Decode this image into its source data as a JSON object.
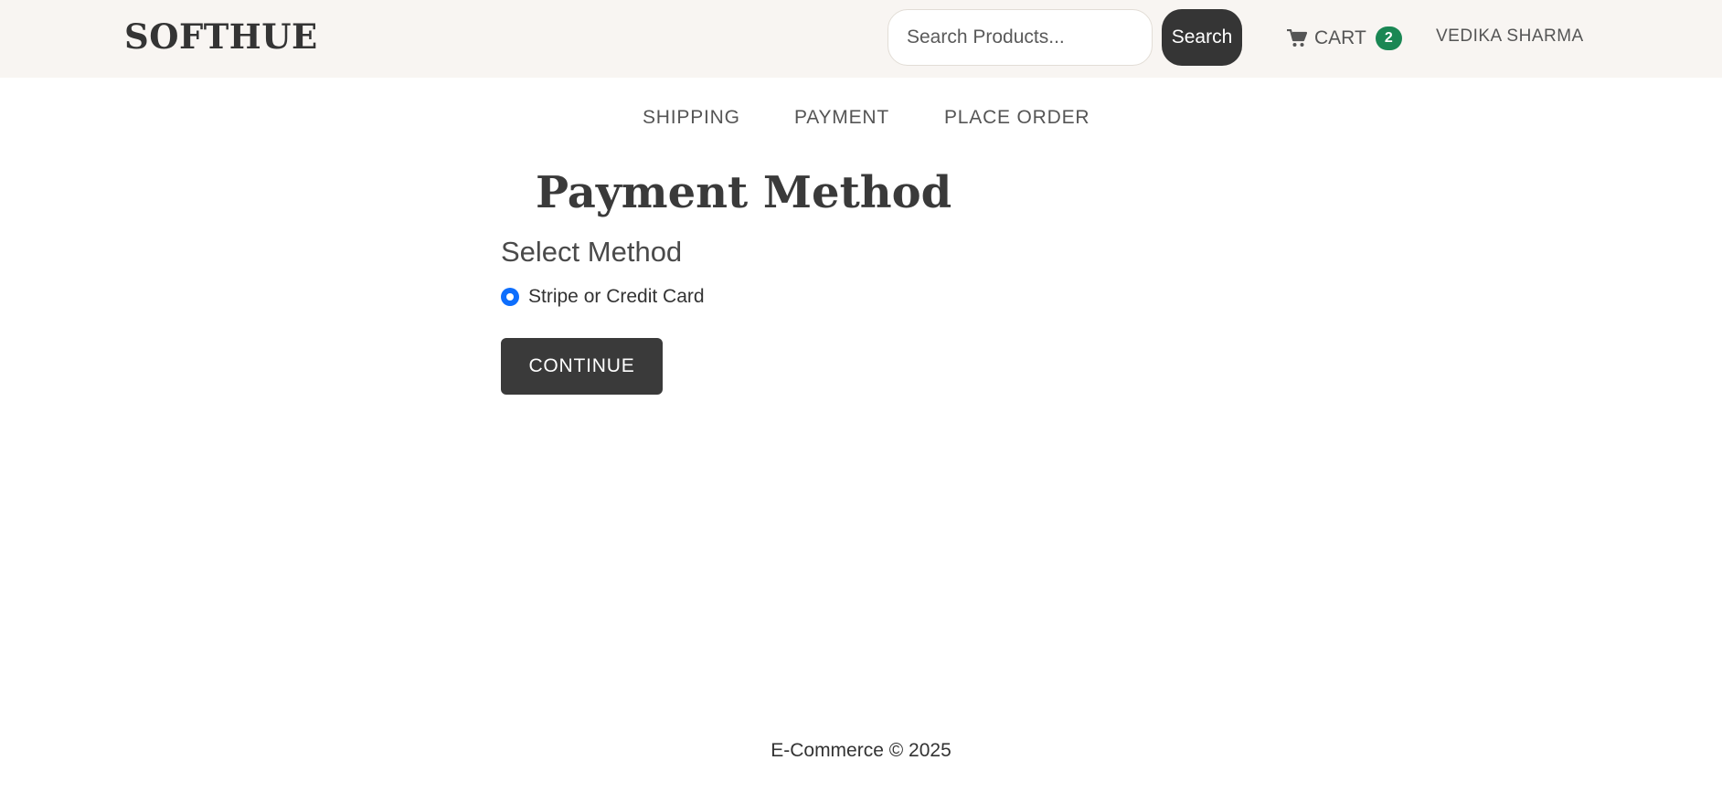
{
  "header": {
    "brand": "SOFTHUE",
    "search": {
      "placeholder": "Search Products...",
      "value": "",
      "button_label": "Search"
    },
    "cart": {
      "label": "CART",
      "count": "2",
      "badge_color": "#1a8754"
    },
    "user_name": "VEDIKA SHARMA"
  },
  "checkout_steps": [
    {
      "label": "SHIPPING"
    },
    {
      "label": "PAYMENT"
    },
    {
      "label": "PLACE ORDER"
    }
  ],
  "main": {
    "title": "Payment Method",
    "subtitle": "Select Method",
    "payment_option": {
      "label": "Stripe or Credit Card",
      "selected": true,
      "accent_color": "#0d6efd"
    },
    "continue_label": "CONTINUE"
  },
  "footer": {
    "text": "E-Commerce © 2025"
  },
  "icons": {
    "cart": "cart-icon"
  }
}
